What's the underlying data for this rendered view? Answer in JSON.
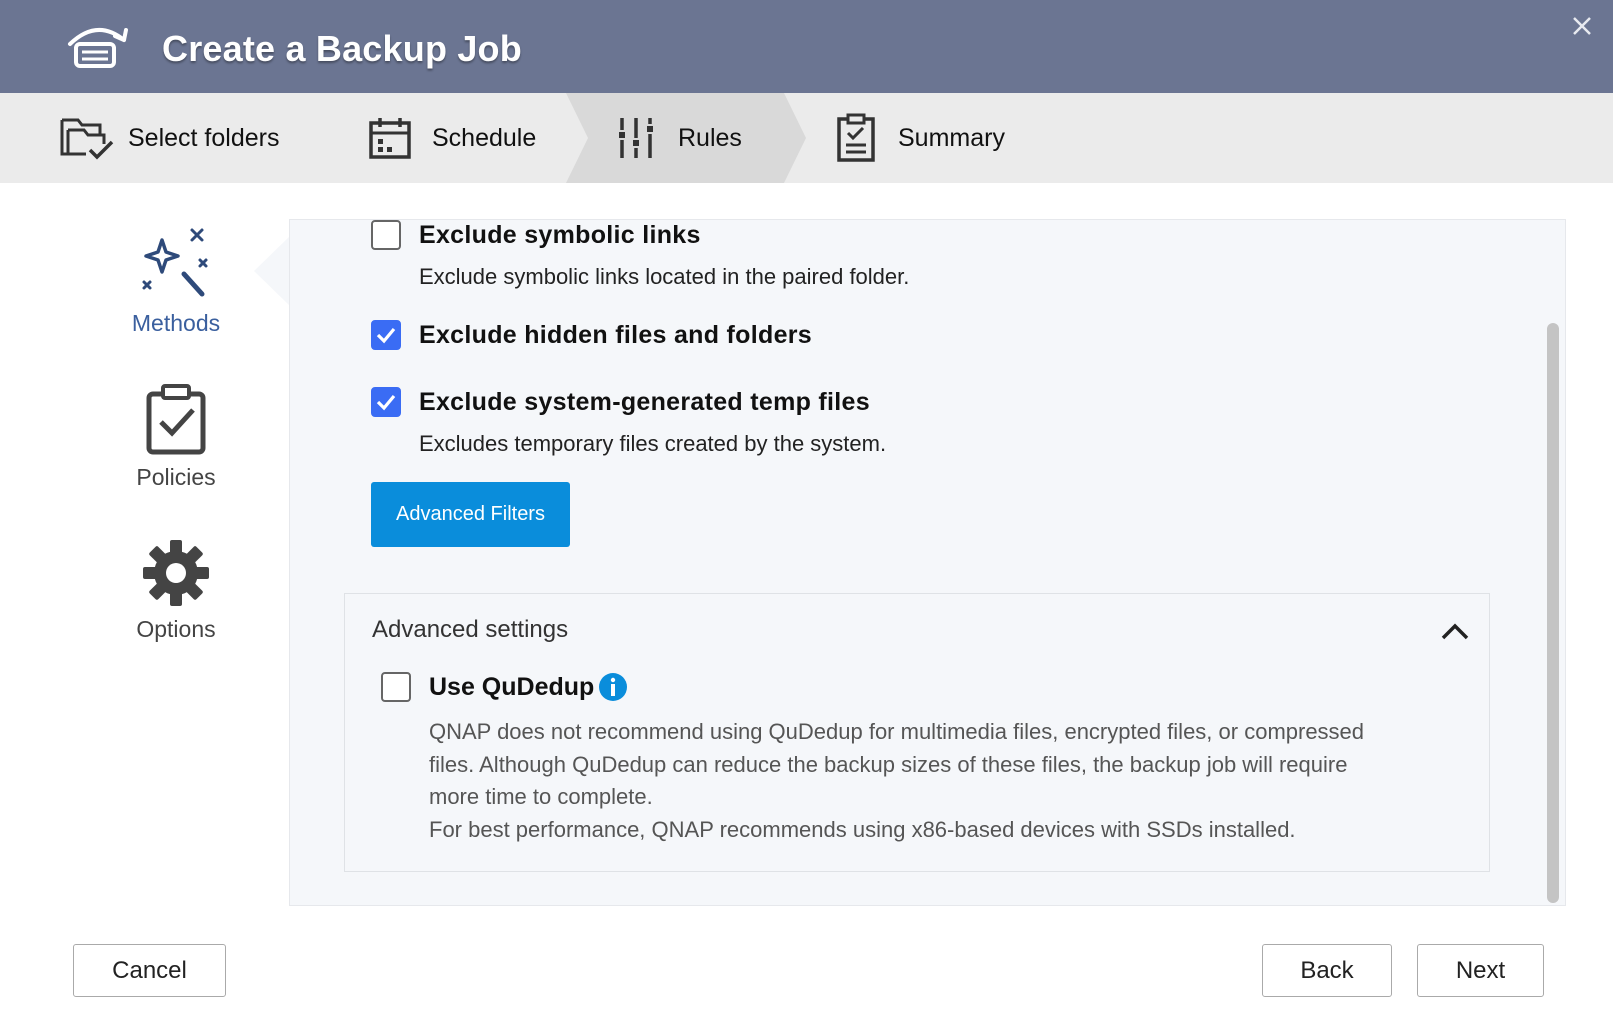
{
  "window": {
    "title": "Create a Backup Job"
  },
  "steps": [
    {
      "label": "Select folders",
      "icon": "folder-check-icon",
      "active": false
    },
    {
      "label": "Schedule",
      "icon": "calendar-icon",
      "active": false
    },
    {
      "label": "Rules",
      "icon": "sliders-icon",
      "active": true
    },
    {
      "label": "Summary",
      "icon": "clipboard-list-icon",
      "active": false
    }
  ],
  "sidenav": [
    {
      "label": "Methods",
      "icon": "magic-wand-icon",
      "active": true
    },
    {
      "label": "Policies",
      "icon": "clipboard-check-icon",
      "active": false
    },
    {
      "label": "Options",
      "icon": "gear-icon",
      "active": false
    }
  ],
  "rules": {
    "symlinks": {
      "title": "Exclude symbolic links",
      "desc": "Exclude symbolic links located in the paired folder.",
      "checked": false
    },
    "hidden": {
      "title": "Exclude hidden files and folders",
      "checked": true
    },
    "temp": {
      "title": "Exclude system-generated temp files",
      "desc": "Excludes temporary files created by the system.",
      "checked": true
    },
    "advanced_filters_label": "Advanced Filters"
  },
  "advanced": {
    "title": "Advanced settings",
    "expanded": true,
    "qudedup": {
      "title": "Use QuDedup",
      "checked": false,
      "desc_lines": [
        "QNAP does not recommend using QuDedup for multimedia files, encrypted files, or compressed",
        "files. Although QuDedup can reduce the backup sizes of these files, the backup job will require",
        "more time to complete.",
        "For best performance, QNAP recommends using x86-based devices with SSDs installed."
      ]
    }
  },
  "footer": {
    "cancel": "Cancel",
    "back": "Back",
    "next": "Next"
  },
  "colors": {
    "titlebar": "#6b7592",
    "accent": "#0a8ddb",
    "checkbox": "#3a6cf4",
    "nav_active": "#3a5f9e"
  }
}
